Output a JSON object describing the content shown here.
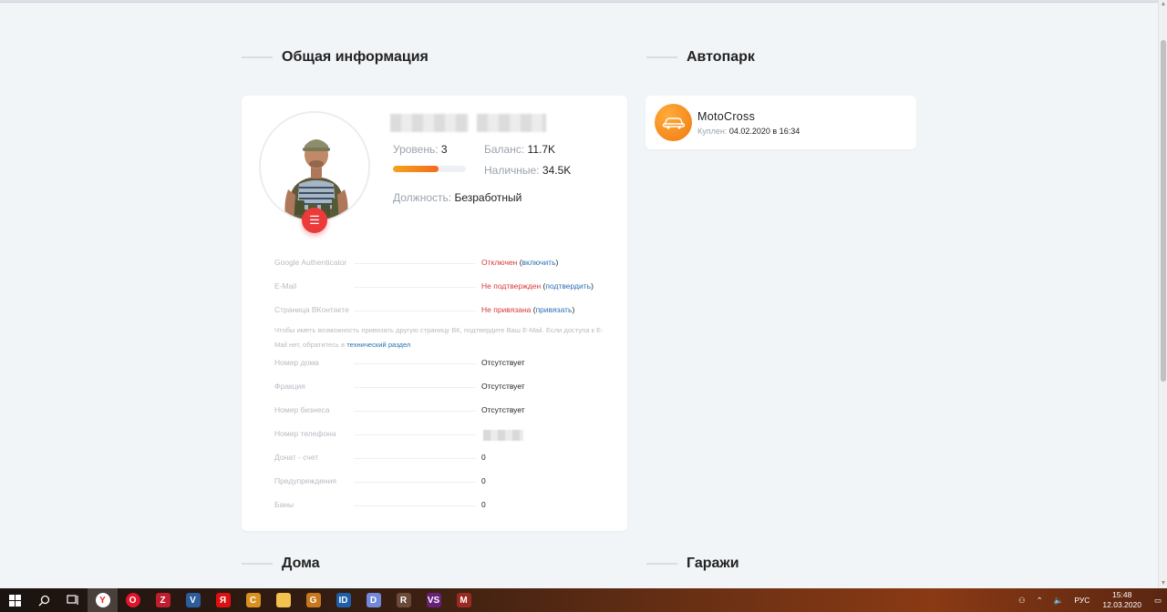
{
  "sections": {
    "general_info": "Общая информация",
    "autopark": "Автопарк",
    "houses": "Дома",
    "garages": "Гаражи"
  },
  "profile": {
    "level_label": "Уровень:",
    "level_value": "3",
    "level_progress": 0.62,
    "balance_label": "Баланс:",
    "balance_value": "11.7K",
    "cash_label": "Наличные:",
    "cash_value": "34.5K",
    "position_label": "Должность:",
    "position_value": "Безработный"
  },
  "security": {
    "google_auth_label": "Google Authenticator",
    "google_auth_status": "Отключен",
    "google_auth_action": "включить",
    "email_label": "E-Mail",
    "email_status": "Не подтвержден",
    "email_action": "подтвердить",
    "vk_label": "Страница ВКонтакте",
    "vk_status": "Не привязана",
    "vk_action": "привязать",
    "note_text": "Чтобы иметь возможность привязать другую страницу ВК, подтвердите Ваш E-Mail. Если доступа к E-Mail нет, обратитесь в",
    "note_link": "технический раздел"
  },
  "details": [
    {
      "label": "Номер дома",
      "value": "Отсутствует"
    },
    {
      "label": "Фракция",
      "value": "Отсутствует"
    },
    {
      "label": "Номер бизнеса",
      "value": "Отсутствует"
    },
    {
      "label": "Номер телефона",
      "value": ""
    },
    {
      "label": "Донат - счет",
      "value": "0"
    },
    {
      "label": "Предупреждения",
      "value": "0"
    },
    {
      "label": "Баны",
      "value": "0"
    }
  ],
  "vehicle": {
    "name": "MotoCross",
    "bought_label": "Куплен:",
    "bought_date": "04.02.2020 в 16:34",
    "icon": "car-icon"
  },
  "taskbar": {
    "apps": [
      "yandex-browser",
      "opera",
      "filezilla",
      "vim",
      "yandex",
      "counter-strike",
      "file-explorer",
      "game",
      "id-app",
      "discord",
      "game2",
      "visual-studio",
      "game3"
    ],
    "lang": "РУС",
    "time": "15:48",
    "date": "12.03.2020"
  },
  "colors": {
    "accent_red": "#ec3a3a",
    "accent_orange": "#f36c1f",
    "link_blue": "#2c6fb6"
  }
}
